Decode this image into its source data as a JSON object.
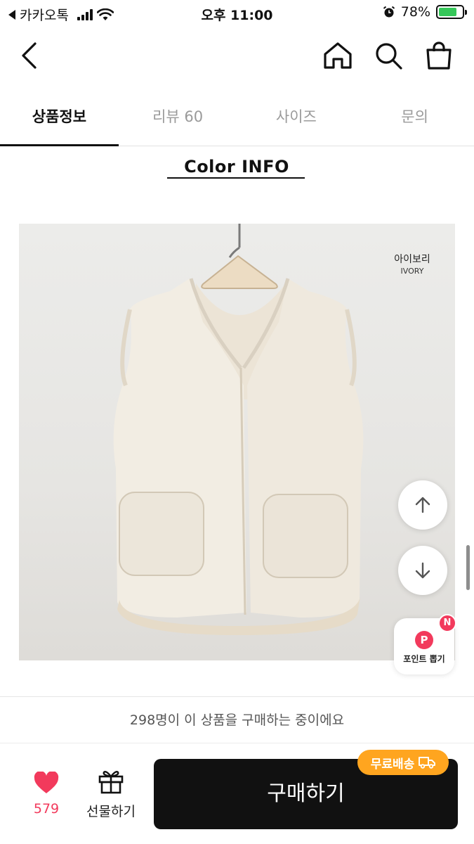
{
  "status_bar": {
    "back_app": "카카오톡",
    "time": "오후 11:00",
    "battery_percent": "78%",
    "battery_level": 0.78
  },
  "tabs": [
    {
      "label": "상품정보",
      "active": true
    },
    {
      "label": "리뷰 60",
      "active": false
    },
    {
      "label": "사이즈",
      "active": false
    },
    {
      "label": "문의",
      "active": false
    }
  ],
  "content": {
    "section_title": "Color INFO",
    "color_name_ko": "아이보리",
    "color_name_en": "IVORY"
  },
  "floating": {
    "point_label": "포인트 뽑기",
    "point_icon": "P",
    "new_badge": "N"
  },
  "bottom": {
    "purchase_notice": "298명이 이 상품을 구매하는 중이에요",
    "like_count": "579",
    "gift_label": "선물하기",
    "buy_label": "구매하기",
    "free_shipping": "무료배송"
  },
  "colors": {
    "accent_pink": "#f23a5c",
    "free_ship_orange": "#ffa51f",
    "buy_button": "#111111"
  }
}
